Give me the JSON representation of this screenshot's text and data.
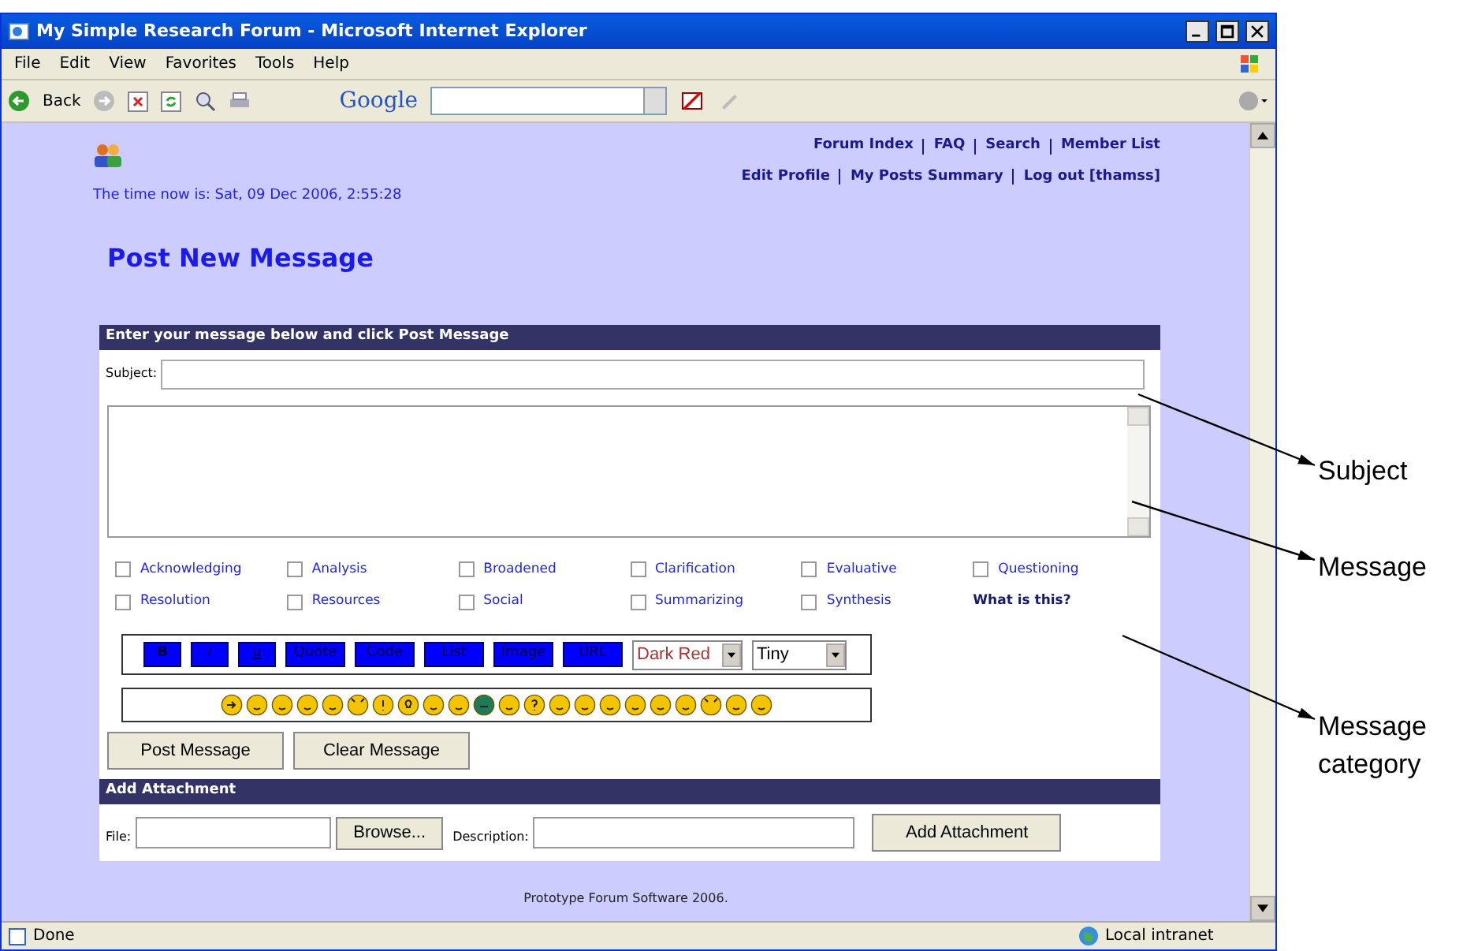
{
  "window": {
    "title": "My Simple Research Forum - Microsoft Internet Explorer"
  },
  "menu": [
    "File",
    "Edit",
    "View",
    "Favorites",
    "Tools",
    "Help"
  ],
  "toolbar": {
    "back": "Back",
    "search_brand": "Google"
  },
  "nav_rows": [
    [
      "Forum Index",
      "FAQ",
      "Search",
      "Member List"
    ],
    [
      "Edit Profile",
      "My Posts Summary",
      "Log out [thamss]"
    ]
  ],
  "time_text": "The time now is: Sat, 09 Dec 2006, 2:55:28",
  "page_title": "Post New Message",
  "form": {
    "header": "Enter your message below and click Post Message",
    "subject_label": "Subject:",
    "categories": [
      {
        "label": "Acknowledging",
        "checked": false
      },
      {
        "label": "Analysis",
        "checked": false
      },
      {
        "label": "Broadened",
        "checked": false
      },
      {
        "label": "Clarification",
        "checked": false
      },
      {
        "label": "Evaluative",
        "checked": false
      },
      {
        "label": "Questioning",
        "checked": false
      },
      {
        "label": "Resolution",
        "checked": false
      },
      {
        "label": "Resources",
        "checked": false
      },
      {
        "label": "Social",
        "checked": false
      },
      {
        "label": "Summarizing",
        "checked": false
      },
      {
        "label": "Synthesis",
        "checked": false
      }
    ],
    "help_link": "What is this?",
    "format_buttons": [
      "B",
      "i",
      "u",
      "Quote",
      "Code",
      "List",
      "Image",
      "URL"
    ],
    "color_select": "Dark Red",
    "size_select": "Tiny",
    "emoticons": [
      {
        "kind": "arrow"
      },
      {
        "kind": "face"
      },
      {
        "kind": "face"
      },
      {
        "kind": "face"
      },
      {
        "kind": "face"
      },
      {
        "kind": "devil"
      },
      {
        "kind": "exclaim"
      },
      {
        "kind": "idea"
      },
      {
        "kind": "face"
      },
      {
        "kind": "face"
      },
      {
        "kind": "green"
      },
      {
        "kind": "face"
      },
      {
        "kind": "question"
      },
      {
        "kind": "face"
      },
      {
        "kind": "face"
      },
      {
        "kind": "face"
      },
      {
        "kind": "face"
      },
      {
        "kind": "face"
      },
      {
        "kind": "face"
      },
      {
        "kind": "devil"
      },
      {
        "kind": "face"
      },
      {
        "kind": "face"
      }
    ],
    "buttons": [
      "Post Message",
      "Clear Message"
    ]
  },
  "attachment": {
    "header": "Add Attachment",
    "file_label": "File:",
    "browse": "Browse...",
    "description_label": "Description:",
    "add_button": "Add Attachment"
  },
  "footer": "Prototype Forum Software 2006.",
  "status_bar": {
    "status": "Done",
    "zone": "Local intranet"
  },
  "annotations": [
    "Subject",
    "Message",
    "Message category"
  ]
}
